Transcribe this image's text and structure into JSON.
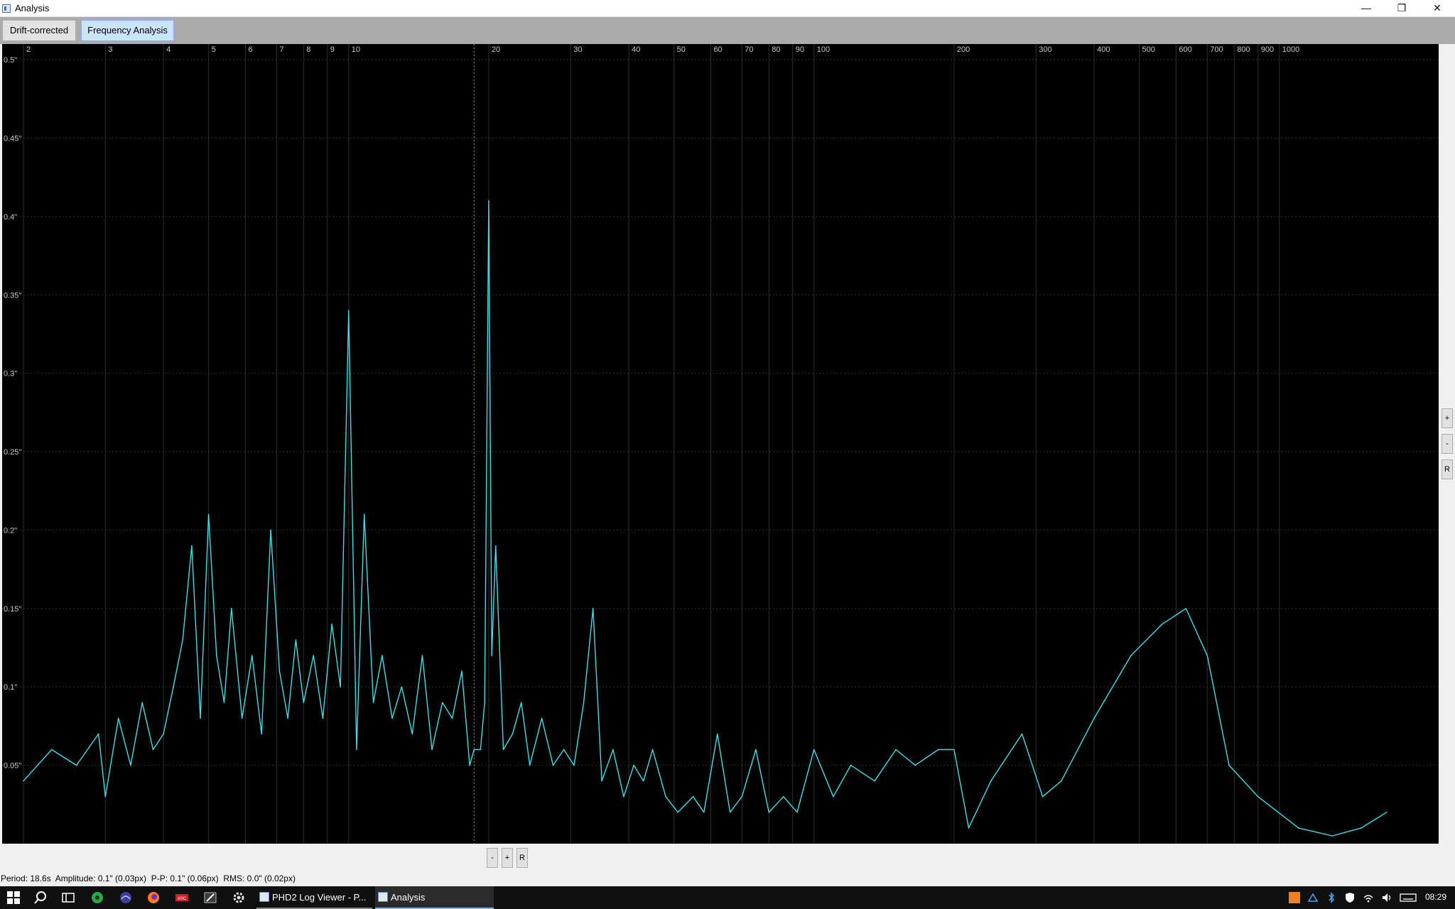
{
  "window": {
    "title": "Analysis",
    "controls": {
      "minimize": "—",
      "maximize": "❐",
      "close": "✕"
    }
  },
  "tabs": [
    {
      "label": "Drift-corrected",
      "active": false
    },
    {
      "label": "Frequency Analysis",
      "active": true
    }
  ],
  "chart_data": {
    "type": "line",
    "x_scale": "log",
    "xlim": [
      1.8,
      2200
    ],
    "ylim": [
      0,
      0.51
    ],
    "x_ticks": [
      "2",
      "3",
      "4",
      "5",
      "6",
      "7",
      "8",
      "9",
      "10",
      "20",
      "30",
      "40",
      "50",
      "60",
      "70",
      "80",
      "90",
      "100",
      "200",
      "300",
      "400",
      "500",
      "600",
      "700",
      "800",
      "900",
      "1000"
    ],
    "y_ticks": [
      "0.5\"",
      "0.45\"",
      "0.4\"",
      "0.35\"",
      "0.3\"",
      "0.25\"",
      "0.2\"",
      "0.15\"",
      "0.1\"",
      "0.05\""
    ],
    "cursor_x": 18.6,
    "line_color": "#3be0e8",
    "series": [
      {
        "points": [
          [
            2.0,
            0.04
          ],
          [
            2.3,
            0.06
          ],
          [
            2.6,
            0.05
          ],
          [
            2.9,
            0.07
          ],
          [
            3.0,
            0.03
          ],
          [
            3.2,
            0.08
          ],
          [
            3.4,
            0.05
          ],
          [
            3.6,
            0.09
          ],
          [
            3.8,
            0.06
          ],
          [
            4.0,
            0.07
          ],
          [
            4.2,
            0.1
          ],
          [
            4.4,
            0.13
          ],
          [
            4.6,
            0.19
          ],
          [
            4.8,
            0.08
          ],
          [
            5.0,
            0.21
          ],
          [
            5.2,
            0.12
          ],
          [
            5.4,
            0.09
          ],
          [
            5.6,
            0.15
          ],
          [
            5.9,
            0.08
          ],
          [
            6.2,
            0.12
          ],
          [
            6.5,
            0.07
          ],
          [
            6.8,
            0.2
          ],
          [
            7.1,
            0.11
          ],
          [
            7.4,
            0.08
          ],
          [
            7.7,
            0.13
          ],
          [
            8.0,
            0.09
          ],
          [
            8.4,
            0.12
          ],
          [
            8.8,
            0.08
          ],
          [
            9.2,
            0.14
          ],
          [
            9.6,
            0.1
          ],
          [
            10.0,
            0.34
          ],
          [
            10.4,
            0.06
          ],
          [
            10.8,
            0.21
          ],
          [
            11.3,
            0.09
          ],
          [
            11.8,
            0.12
          ],
          [
            12.4,
            0.08
          ],
          [
            13.0,
            0.1
          ],
          [
            13.7,
            0.07
          ],
          [
            14.4,
            0.12
          ],
          [
            15.1,
            0.06
          ],
          [
            15.9,
            0.09
          ],
          [
            16.7,
            0.08
          ],
          [
            17.5,
            0.11
          ],
          [
            18.2,
            0.05
          ],
          [
            18.6,
            0.06
          ],
          [
            19.2,
            0.06
          ],
          [
            19.6,
            0.09
          ],
          [
            20.0,
            0.41
          ],
          [
            20.3,
            0.12
          ],
          [
            20.7,
            0.19
          ],
          [
            21.5,
            0.06
          ],
          [
            22.5,
            0.07
          ],
          [
            23.5,
            0.09
          ],
          [
            24.5,
            0.05
          ],
          [
            26.0,
            0.08
          ],
          [
            27.5,
            0.05
          ],
          [
            29.0,
            0.06
          ],
          [
            30.5,
            0.05
          ],
          [
            32.0,
            0.09
          ],
          [
            33.5,
            0.15
          ],
          [
            35.0,
            0.04
          ],
          [
            37.0,
            0.06
          ],
          [
            39.0,
            0.03
          ],
          [
            41.0,
            0.05
          ],
          [
            43.0,
            0.04
          ],
          [
            45.0,
            0.06
          ],
          [
            48.0,
            0.03
          ],
          [
            51.0,
            0.02
          ],
          [
            55.0,
            0.03
          ],
          [
            58.0,
            0.02
          ],
          [
            62.0,
            0.07
          ],
          [
            66.0,
            0.02
          ],
          [
            70.0,
            0.03
          ],
          [
            75.0,
            0.06
          ],
          [
            80.0,
            0.02
          ],
          [
            86.0,
            0.03
          ],
          [
            92.0,
            0.02
          ],
          [
            100.0,
            0.06
          ],
          [
            110.0,
            0.03
          ],
          [
            120.0,
            0.05
          ],
          [
            135.0,
            0.04
          ],
          [
            150.0,
            0.06
          ],
          [
            165.0,
            0.05
          ],
          [
            185.0,
            0.06
          ],
          [
            200.0,
            0.06
          ],
          [
            215.0,
            0.01
          ],
          [
            240.0,
            0.04
          ],
          [
            280.0,
            0.07
          ],
          [
            310.0,
            0.03
          ],
          [
            340.0,
            0.04
          ],
          [
            400.0,
            0.08
          ],
          [
            480.0,
            0.12
          ],
          [
            560.0,
            0.14
          ],
          [
            630.0,
            0.15
          ],
          [
            700.0,
            0.12
          ],
          [
            780.0,
            0.05
          ],
          [
            900.0,
            0.03
          ],
          [
            1100.0,
            0.01
          ],
          [
            1300.0,
            0.005
          ],
          [
            1500.0,
            0.01
          ],
          [
            1700.0,
            0.02
          ]
        ]
      }
    ]
  },
  "zoom_controls": {
    "y_plus": "+",
    "y_minus": "-",
    "y_reset": "R",
    "x_minus": "-",
    "x_plus": "+",
    "x_reset": "R"
  },
  "status_bar": {
    "text": "Period: 18.6s  Amplitude: 0.1\" (0.03px)  P-P: 0.1\" (0.06px)  RMS: 0.0\" (0.02px)"
  },
  "taskbar": {
    "apps": [
      {
        "label": "PHD2 Log Viewer - P...",
        "active": false
      },
      {
        "label": "Analysis",
        "active": true
      }
    ],
    "clock": "08:29",
    "pinned_icons": [
      "start-icon",
      "search-icon",
      "task-view-icon",
      "sharpcap-icon",
      "stellarium-icon",
      "firefox-icon",
      "ascom-icon",
      "pencil-icon",
      "settings-icon"
    ]
  }
}
